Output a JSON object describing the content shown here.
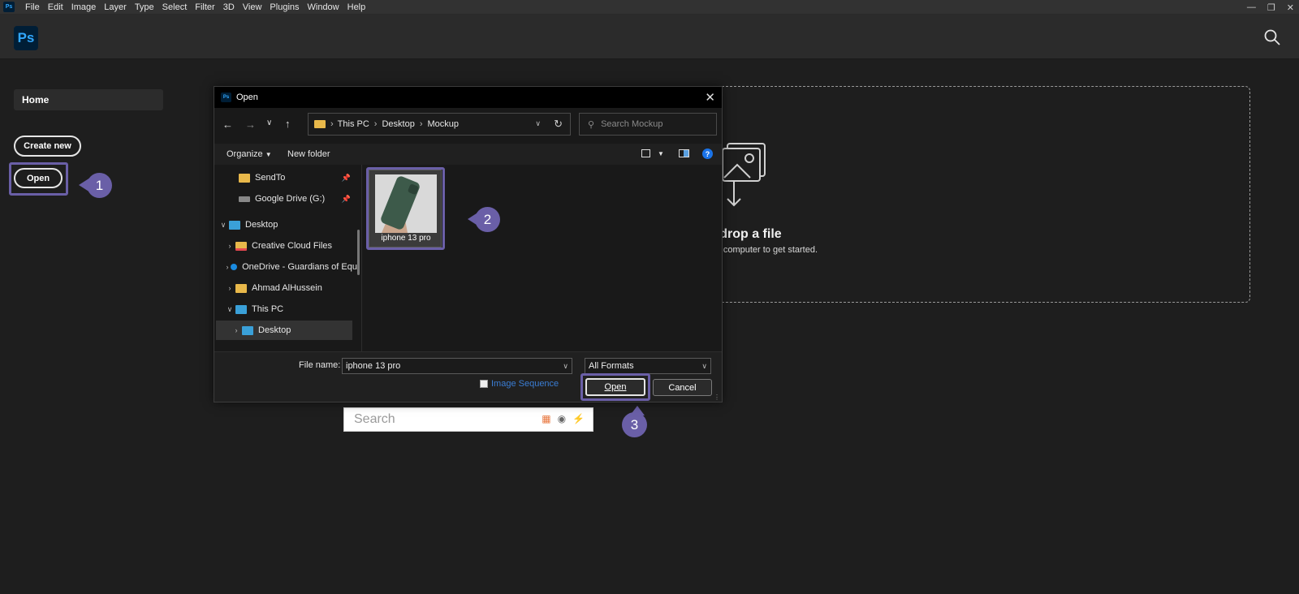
{
  "menubar": {
    "app_badge": "Ps",
    "items": [
      "File",
      "Edit",
      "Image",
      "Layer",
      "Type",
      "Select",
      "Filter",
      "3D",
      "View",
      "Plugins",
      "Window",
      "Help"
    ]
  },
  "header": {
    "logo": "Ps"
  },
  "nav": {
    "home": "Home",
    "create_new": "Create new",
    "open": "Open"
  },
  "steps": {
    "one": "1",
    "two": "2",
    "three": "3"
  },
  "dropzone": {
    "title": "d drop a file",
    "subtitle": "ur computer to get started."
  },
  "bottom_search": {
    "placeholder": "Search"
  },
  "dialog": {
    "title": "Open",
    "address": {
      "root": "This PC",
      "crumb1": "Desktop",
      "crumb2": "Mockup"
    },
    "search_placeholder": "Search Mockup",
    "toolbar": {
      "organize": "Organize",
      "new_folder": "New folder"
    },
    "tree": [
      {
        "label": "SendTo"
      },
      {
        "label": "Google Drive (G:)"
      },
      {
        "label": "Desktop"
      },
      {
        "label": "Creative Cloud Files"
      },
      {
        "label": "OneDrive - Guardians of Equ"
      },
      {
        "label": "Ahmad AlHussein"
      },
      {
        "label": "This PC"
      },
      {
        "label": "Desktop"
      }
    ],
    "file": {
      "name": "iphone 13 pro"
    },
    "file_name_label": "File name:",
    "file_name_value": "iphone 13 pro",
    "format": "All Formats",
    "image_sequence": "Image Sequence",
    "open_button": "Open",
    "cancel_button": "Cancel"
  },
  "colors": {
    "step_badge": "#6a5fa7",
    "ps_blue": "#31a8ff",
    "ps_navy": "#001e36",
    "link_blue": "#3a7dd4"
  }
}
